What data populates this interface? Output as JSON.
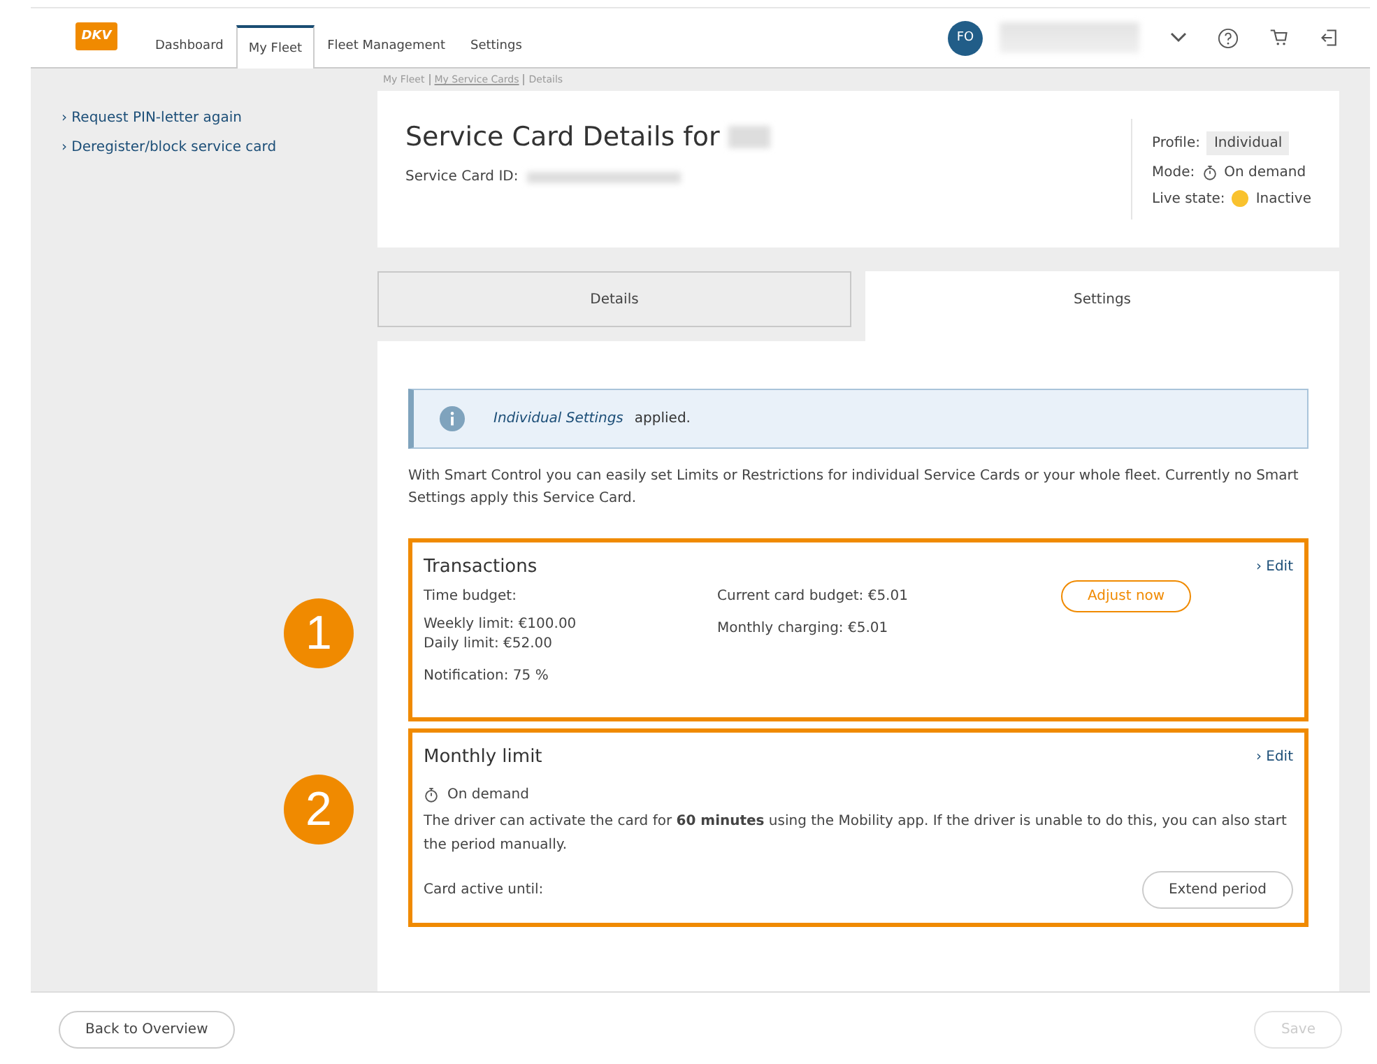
{
  "header": {
    "logo": "DKV",
    "nav": [
      {
        "label": "Dashboard",
        "selected": false
      },
      {
        "label": "My Fleet",
        "selected": true
      },
      {
        "label": "Fleet Management",
        "selected": false
      },
      {
        "label": "Settings",
        "selected": false
      }
    ],
    "avatar": "FO"
  },
  "breadcrumb": [
    {
      "label": "My Fleet",
      "link": false
    },
    {
      "label": "My Service Cards",
      "link": true
    },
    {
      "label": "Details",
      "link": false
    }
  ],
  "sidebar": {
    "links": [
      "› Request PIN-letter again",
      "› Deregister/block service card"
    ]
  },
  "card": {
    "title": "Service Card Details for",
    "id_label": "Service Card ID:",
    "profile_label": "Profile:",
    "profile": "Individual",
    "mode_label": "Mode:",
    "mode": "On demand",
    "live_label": "Live state:",
    "live_state": {
      "label": "Inactive",
      "color": "#f9c22e"
    }
  },
  "tabs": [
    {
      "label": "Details",
      "selected": false
    },
    {
      "label": "Settings",
      "selected": true
    }
  ],
  "info": {
    "link": "Individual Settings",
    "text": "applied."
  },
  "intro": "With Smart Control you can easily set Limits or Restrictions for individual Service Cards or your whole fleet. Currently no Smart Settings apply this Service Card.",
  "transactions": {
    "marker": "1",
    "title": "Transactions",
    "edit": "› Edit",
    "left": [
      "Time budget:",
      "Weekly limit: €100.00",
      "Daily limit: €52.00",
      "Notification: 75 %"
    ],
    "right": [
      "Current card budget: €5.01",
      "Monthly charging: €5.01"
    ],
    "button": "Adjust now"
  },
  "monthly_limit": {
    "marker": "2",
    "title": "Monthly limit",
    "edit": "› Edit",
    "mode": "On demand",
    "text": "The driver can activate the card for **60 minutes** using the Mobility app. If the driver is unable to do this, you can also start the period manually.",
    "active_label": "Card active until:",
    "button": "Extend period"
  },
  "footer": {
    "back": "Back to Overview",
    "save": "Save",
    "save_disabled": true
  }
}
